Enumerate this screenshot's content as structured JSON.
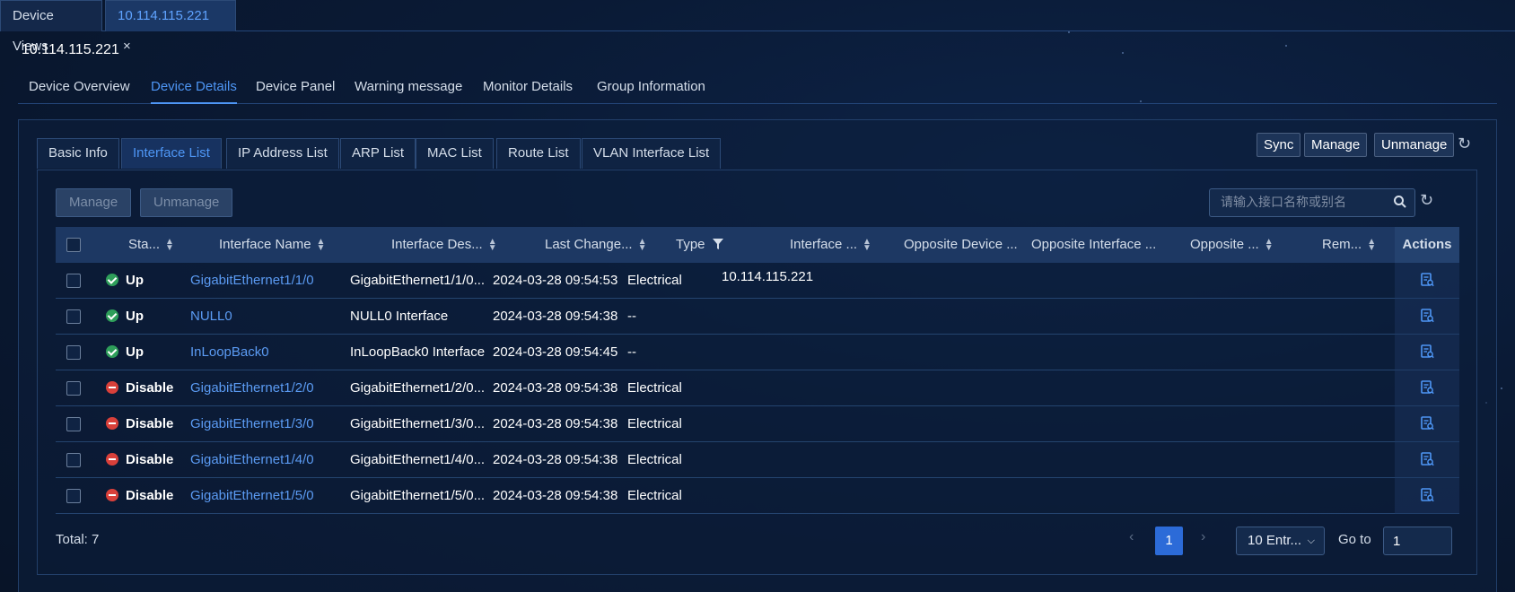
{
  "window_tabs": [
    {
      "label": "Device Views"
    },
    {
      "label": "10.114.115.221",
      "close": "×"
    }
  ],
  "device_title": "10.114.115.221",
  "page_tabs": [
    "Device Overview",
    "Device Details",
    "Device Panel",
    "Warning message",
    "Monitor Details",
    "Group Information"
  ],
  "sub_tabs": [
    "Basic Info",
    "Interface List",
    "IP Address List",
    "ARP List",
    "MAC List",
    "Route List",
    "VLAN Interface List"
  ],
  "top_actions": {
    "sync": "Sync",
    "manage": "Manage",
    "unmanage": "Unmanage"
  },
  "table_actions": {
    "manage": "Manage",
    "unmanage": "Unmanage"
  },
  "search": {
    "placeholder": "请输入接口名称或别名"
  },
  "columns": [
    "Sta...",
    "Interface Name",
    "Interface Des...",
    "Last Change...",
    "Type",
    "Interface ...",
    "Opposite Device ...",
    "Opposite Interface ...",
    "Opposite ...",
    "Rem...",
    "Actions"
  ],
  "rows": [
    {
      "status": "Up",
      "name": "GigabitEthernet1/1/0",
      "desc": "GigabitEthernet1/1/0...",
      "last_change": "2024-03-28 09:54:53",
      "type": "Electrical",
      "interface_ip": "10.114.115.221"
    },
    {
      "status": "Up",
      "name": "NULL0",
      "desc": "NULL0 Interface",
      "last_change": "2024-03-28 09:54:38",
      "type": "--",
      "interface_ip": ""
    },
    {
      "status": "Up",
      "name": "InLoopBack0",
      "desc": "InLoopBack0 Interface",
      "last_change": "2024-03-28 09:54:45",
      "type": "--",
      "interface_ip": ""
    },
    {
      "status": "Disable",
      "name": "GigabitEthernet1/2/0",
      "desc": "GigabitEthernet1/2/0...",
      "last_change": "2024-03-28 09:54:38",
      "type": "Electrical",
      "interface_ip": ""
    },
    {
      "status": "Disable",
      "name": "GigabitEthernet1/3/0",
      "desc": "GigabitEthernet1/3/0...",
      "last_change": "2024-03-28 09:54:38",
      "type": "Electrical",
      "interface_ip": ""
    },
    {
      "status": "Disable",
      "name": "GigabitEthernet1/4/0",
      "desc": "GigabitEthernet1/4/0...",
      "last_change": "2024-03-28 09:54:38",
      "type": "Electrical",
      "interface_ip": ""
    },
    {
      "status": "Disable",
      "name": "GigabitEthernet1/5/0",
      "desc": "GigabitEthernet1/5/0...",
      "last_change": "2024-03-28 09:54:38",
      "type": "Electrical",
      "interface_ip": ""
    }
  ],
  "footer": {
    "total": "Total: 7",
    "current_page": "1",
    "page_size": "10 Entr...",
    "goto_label": "Go to",
    "goto_value": "1"
  },
  "colors": {
    "accent": "#4e96f5",
    "status_up": "#2e9e5a",
    "status_disable": "#d9403a",
    "link": "#5b9bf3"
  }
}
